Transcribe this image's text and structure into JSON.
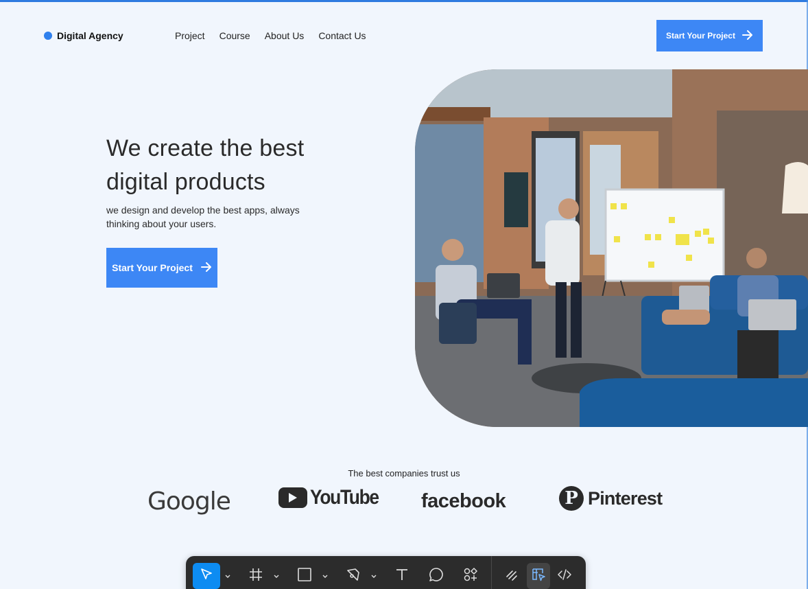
{
  "brand": {
    "name": "Digital Agency",
    "accent": "#2f80ed"
  },
  "nav": {
    "items": [
      "Project",
      "Course",
      "About Us",
      "Contact Us"
    ]
  },
  "header": {
    "cta_label": "Start Your Project",
    "cta_icon": "arrow-right-icon"
  },
  "hero": {
    "title_line1": "We create the best",
    "title_line2": "digital products",
    "subtitle": "we design and develop the best apps, always thinking about your users.",
    "cta_label": "Start Your Project",
    "cta_icon": "arrow-right-icon",
    "image_subject": "team-meeting-photo"
  },
  "trust": {
    "label": "The best companies trust us",
    "logos": [
      "Google",
      "YouTube",
      "facebook",
      "Pinterest"
    ]
  },
  "toolbar": {
    "tools": [
      "move-tool",
      "frame-tool",
      "shape-tool",
      "pen-tool",
      "text-tool",
      "comment-tool",
      "actions-tool",
      "draw-mode",
      "design-mode",
      "dev-mode"
    ],
    "active_tool": "move-tool"
  },
  "colors": {
    "background": "#f1f6fd",
    "primary_button": "#3d87f5",
    "toolbar_bg": "#2c2c2c",
    "toolbar_active": "#0d8cf2"
  }
}
